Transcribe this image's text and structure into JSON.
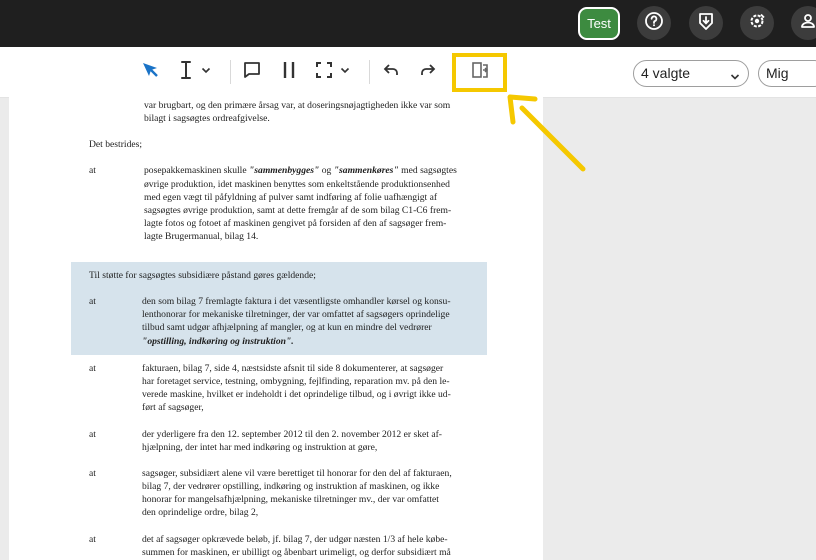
{
  "topbar": {
    "test_label": "Test",
    "icons": [
      "help-icon",
      "download-shield-icon",
      "admin-settings-icon",
      "account-icon"
    ]
  },
  "toolbar": {
    "tools": [
      "pointer-icon",
      "text-cursor-icon",
      "comment-icon",
      "columns-icon",
      "area-select-icon",
      "undo-icon",
      "redo-icon",
      "split-view-icon"
    ],
    "filter_select": "4 valgte",
    "user_select": "Mig"
  },
  "colors": {
    "highlight_border": "#f5c800",
    "test_button": "#3d8b40",
    "selection_highlight": "#d6e3ec"
  },
  "document": {
    "top1": "var brugbart, og den primære årsag var, at doseringsnøjagtigheden ikke var som",
    "top2": "bilagt i sagsøgtes ordreafgivelse.",
    "bestrides": "Det bestrides;",
    "at": "at",
    "b1_1a": "posepakkemaskinen skulle ",
    "b1_1b": "\"sammenbygges\"",
    "b1_1c": " og ",
    "b1_1d": "\"sammenkøres\"",
    "b1_1e": " med sagsøgtes",
    "b1_2": "øvrige produktion, idet maskinen benyttes som enkeltstående produktionsenhed",
    "b1_3": "med egen vægt til påfyldning af pulver samt indføring af folie uafhængigt af",
    "b1_4": "sagsøgtes øvrige produktion, samt at dette fremgår af de som bilag C1-C6 frem-",
    "b1_5": "lagte fotos og fotoet af maskinen gengivet på forsiden af den af sagsøger frem-",
    "b1_6": "lagte Brugermanual, bilag 14.",
    "support": "Til støtte for sagsøgtes subsidiære påstand gøres gældende;",
    "b2_1": "den som bilag 7 fremlagte faktura i det væsentligste omhandler kørsel og konsu-",
    "b2_2": "lenthonorar for mekaniske tilretninger, der var omfattet af sagsøgers oprindelige",
    "b2_3": "tilbud samt udgør afhjælpning af mangler, og at kun en mindre del vedrører",
    "b2_4": "\"opstilling, indkøring og instruktion\".",
    "b3_1": "fakturaen, bilag 7, side 4, næstsidste afsnit til side 8 dokumenterer, at sagsøger",
    "b3_2": "har foretaget service, testning, ombygning, fejlfinding, reparation mv. på den le-",
    "b3_3": "verede maskine, hvilket er indeholdt i det oprindelige tilbud, og i øvrigt ikke ud-",
    "b3_4": "ført af sagsøger,",
    "b4_1": "der yderligere fra den 12. september 2012 til den 2. november 2012 er sket af-",
    "b4_2": "hjælpning, der intet har med indkøring og instruktion at gøre,",
    "b5_1": "sagsøger, subsidiært alene vil være berettiget til honorar for den del af fakturaen,",
    "b5_2": "bilag 7, der vedrører opstilling, indkøring og instruktion af maskinen, og ikke",
    "b5_3": "honorar for mangelsafhjælpning, mekaniske tilretninger mv., der var omfattet",
    "b5_4": "den oprindelige ordre, bilag 2,",
    "b6_1": "det af sagsøger opkrævede beløb, jf. bilag 7, der udgør næsten 1/3 af hele købe-",
    "b6_2": "summen for maskinen, er ubilligt og åbenbart urimeligt, og derfor subsidiært må"
  }
}
